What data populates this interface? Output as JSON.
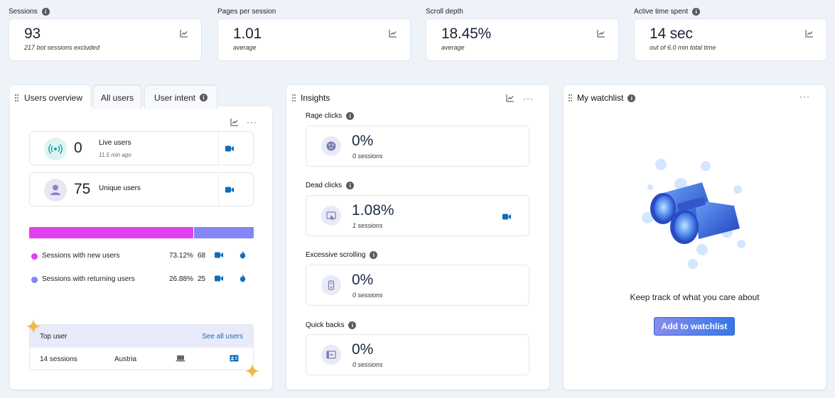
{
  "metrics": [
    {
      "label": "Sessions",
      "value": "93",
      "sub": "217 bot sessions excluded",
      "info": true
    },
    {
      "label": "Pages per session",
      "value": "1.01",
      "sub": "average",
      "info": false
    },
    {
      "label": "Scroll depth",
      "value": "18.45%",
      "sub": "average",
      "info": false
    },
    {
      "label": "Active time spent",
      "value": "14 sec",
      "sub": "out of 6.0 min total time",
      "info": true
    }
  ],
  "users_panel": {
    "tabs": [
      {
        "label": "Users overview",
        "active": true
      },
      {
        "label": "All users",
        "active": false
      },
      {
        "label": "User intent",
        "active": false
      }
    ],
    "live": {
      "value": "0",
      "label": "Live users",
      "sub": "11.5 min ago"
    },
    "unique": {
      "value": "75",
      "label": "Unique users"
    },
    "split": {
      "new_fraction": 0.7312,
      "new_color": "#e23ff0",
      "returning_color": "#8585f5"
    },
    "rows": [
      {
        "name": "Sessions with new users",
        "pct": "73.12%",
        "count": "68",
        "color": "#e23ff0"
      },
      {
        "name": "Sessions with returning users",
        "pct": "26.88%",
        "count": "25",
        "color": "#8585f5"
      }
    ],
    "top_user": {
      "title": "Top user",
      "link": "See all users",
      "sessions": "14 sessions",
      "country": "Austria"
    }
  },
  "insights": {
    "title": "Insights",
    "items": [
      {
        "label": "Rage clicks",
        "value": "0%",
        "sub": "0 sessions",
        "icon": "angry-face-icon",
        "recording": false
      },
      {
        "label": "Dead clicks",
        "value": "1.08%",
        "sub": "1 sessions",
        "icon": "dead-click-icon",
        "recording": true
      },
      {
        "label": "Excessive scrolling",
        "value": "0%",
        "sub": "0 sessions",
        "icon": "scroll-icon",
        "recording": false
      },
      {
        "label": "Quick backs",
        "value": "0%",
        "sub": "0 sessions",
        "icon": "quick-back-icon",
        "recording": false
      }
    ]
  },
  "watchlist": {
    "title": "My watchlist",
    "message": "Keep track of what you care about",
    "button": "Add to watchlist"
  },
  "colors": {
    "accent": "#0f6cbd",
    "value_text": "#1b2233"
  }
}
